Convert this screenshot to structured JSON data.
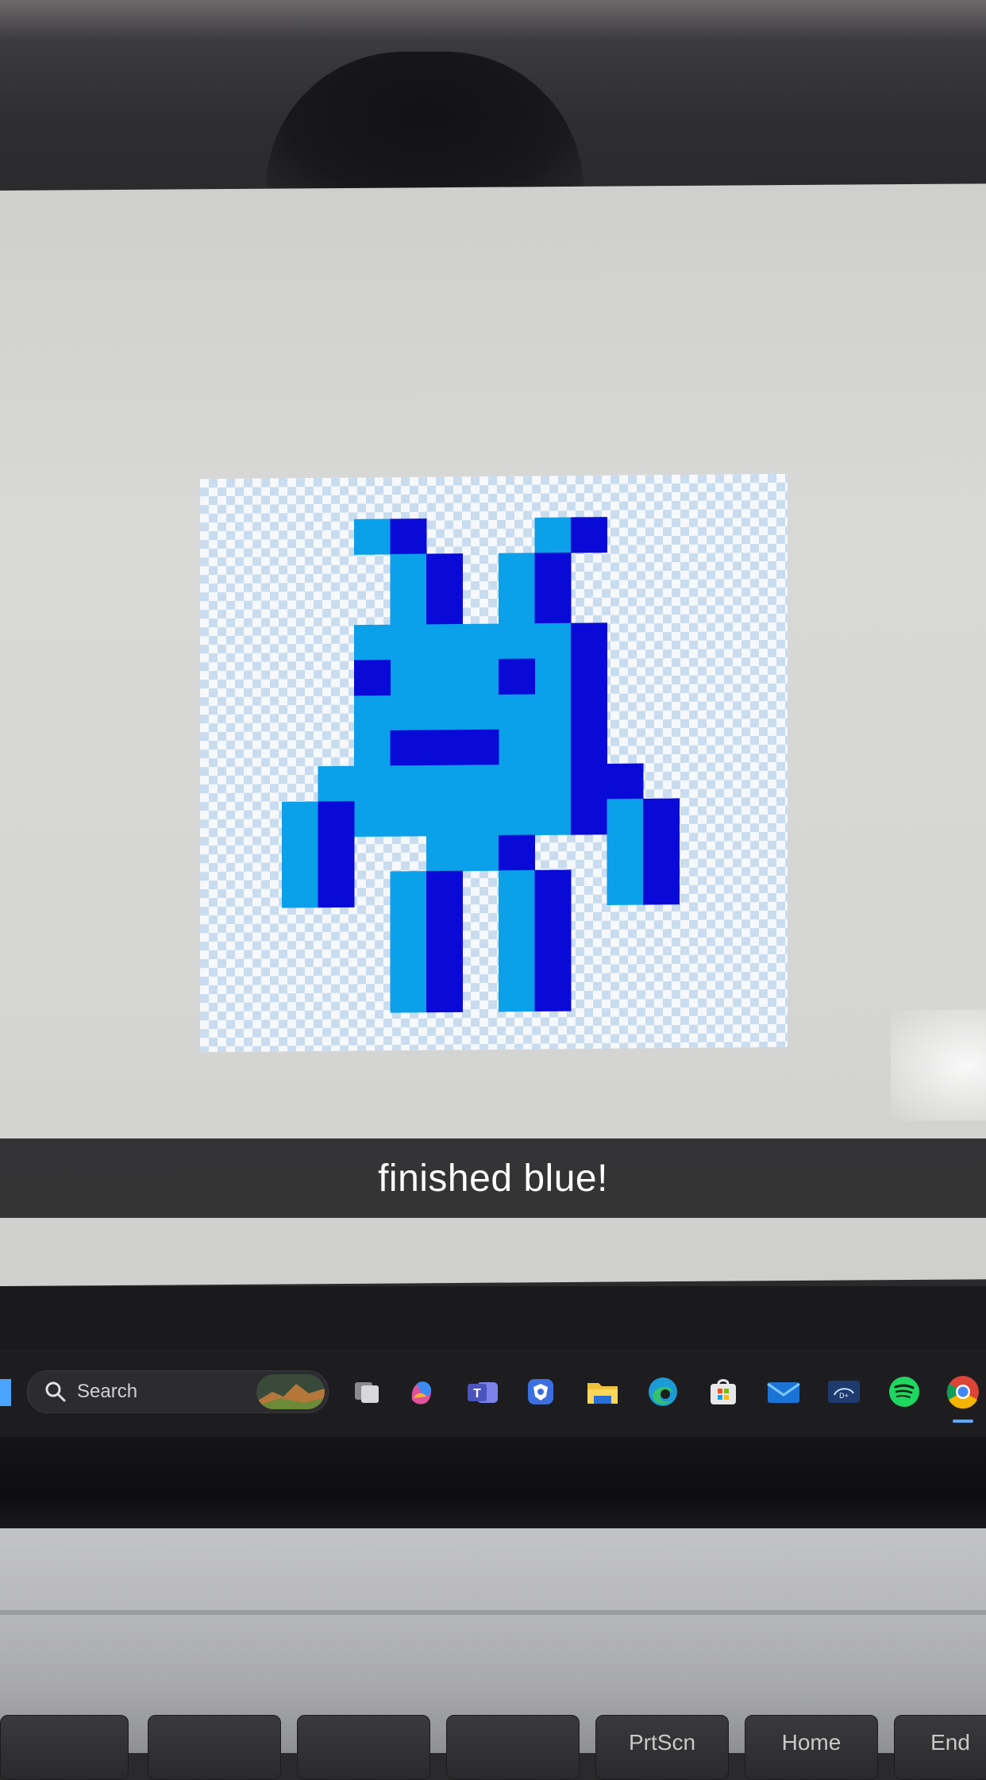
{
  "caption": {
    "text": "finished blue!"
  },
  "taskbar": {
    "search_label": "Search",
    "icons": [
      "start-icon",
      "task-view-icon",
      "copilot-icon",
      "teams-icon",
      "shield-app-icon",
      "file-explorer-icon",
      "edge-icon",
      "microsoft-store-icon",
      "mail-icon",
      "disney-plus-icon",
      "spotify-icon",
      "chrome-icon"
    ]
  },
  "keyboard": {
    "keys": [
      "",
      "",
      "",
      "",
      "PrtScn",
      "Home",
      "End"
    ]
  },
  "sprite": {
    "colors": {
      "light": "#0aa0ea",
      "dark": "#0a0ad8"
    }
  }
}
